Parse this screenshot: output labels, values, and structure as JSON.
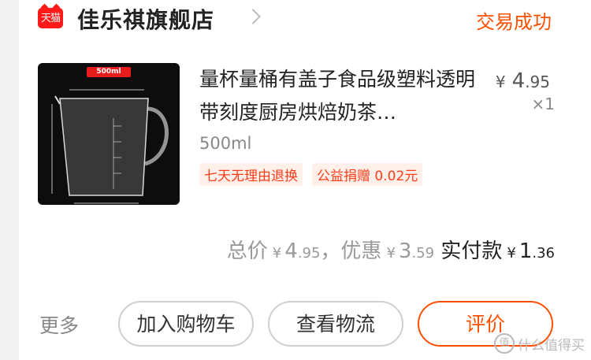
{
  "shop": {
    "badge": "天猫",
    "name": "佳乐祺旗舰店",
    "status": "交易成功"
  },
  "item": {
    "image_caption": "500ml",
    "title": "量杯量桶有盖子食品级塑料透明带刻度厨房烘焙奶茶…",
    "price": {
      "currency": "¥",
      "int": "4",
      "dec": ".95"
    },
    "quantity": "×1",
    "spec": "500ml",
    "tags": [
      "七天无理由退换",
      "公益捐赠 0.02元"
    ]
  },
  "summary": {
    "total_label": "总价",
    "total_int": "4",
    "total_dec": ".95",
    "comma": "，",
    "discount_label": "优惠",
    "discount_int": "3",
    "discount_dec": ".59",
    "paid_label": "实付款",
    "paid_int": "1",
    "paid_dec": ".36",
    "currency": "¥"
  },
  "actions": {
    "more": "更多",
    "add_to_cart": "加入购物车",
    "logistics": "查看物流",
    "review": "评价"
  },
  "watermark": {
    "icon": "值",
    "text": "什么值得买"
  },
  "colors": {
    "accent": "#ff5000",
    "tmall": "#ff1a1a"
  }
}
